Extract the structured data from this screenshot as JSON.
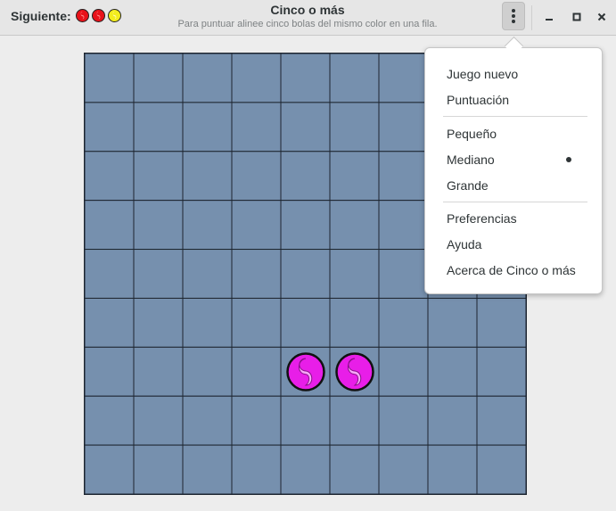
{
  "header": {
    "next_label": "Siguiente:",
    "next_balls": [
      {
        "color": "#e8121a",
        "icon": "red-ball-icon"
      },
      {
        "color": "#e8121a",
        "icon": "red-ball-icon"
      },
      {
        "color": "#f2ec1e",
        "icon": "yellow-ball-icon"
      }
    ],
    "title": "Cinco o más",
    "subtitle": "Para puntuar alinee cinco bolas del mismo color en una fila.",
    "menu_icon": "vertical-dots-icon",
    "window_buttons": [
      "minimize-icon",
      "maximize-icon",
      "close-icon"
    ]
  },
  "board": {
    "rows": 9,
    "columns": 9,
    "cell_color": "#7690ae",
    "grid_color": "#1d2530",
    "balls": [
      {
        "row": 7,
        "column": 5,
        "color": "#e81ee8",
        "icon": "magenta-ball-icon"
      },
      {
        "row": 7,
        "column": 6,
        "color": "#e81ee8",
        "icon": "magenta-ball-icon"
      }
    ]
  },
  "menu": {
    "items": [
      {
        "label": "Juego nuevo"
      },
      {
        "label": "Puntuación"
      },
      {
        "label": "Pequeño"
      },
      {
        "label": "Mediano",
        "selected": true
      },
      {
        "label": "Grande"
      },
      {
        "label": "Preferencias"
      },
      {
        "label": "Ayuda"
      },
      {
        "label": "Acerca de Cinco o más"
      }
    ]
  }
}
